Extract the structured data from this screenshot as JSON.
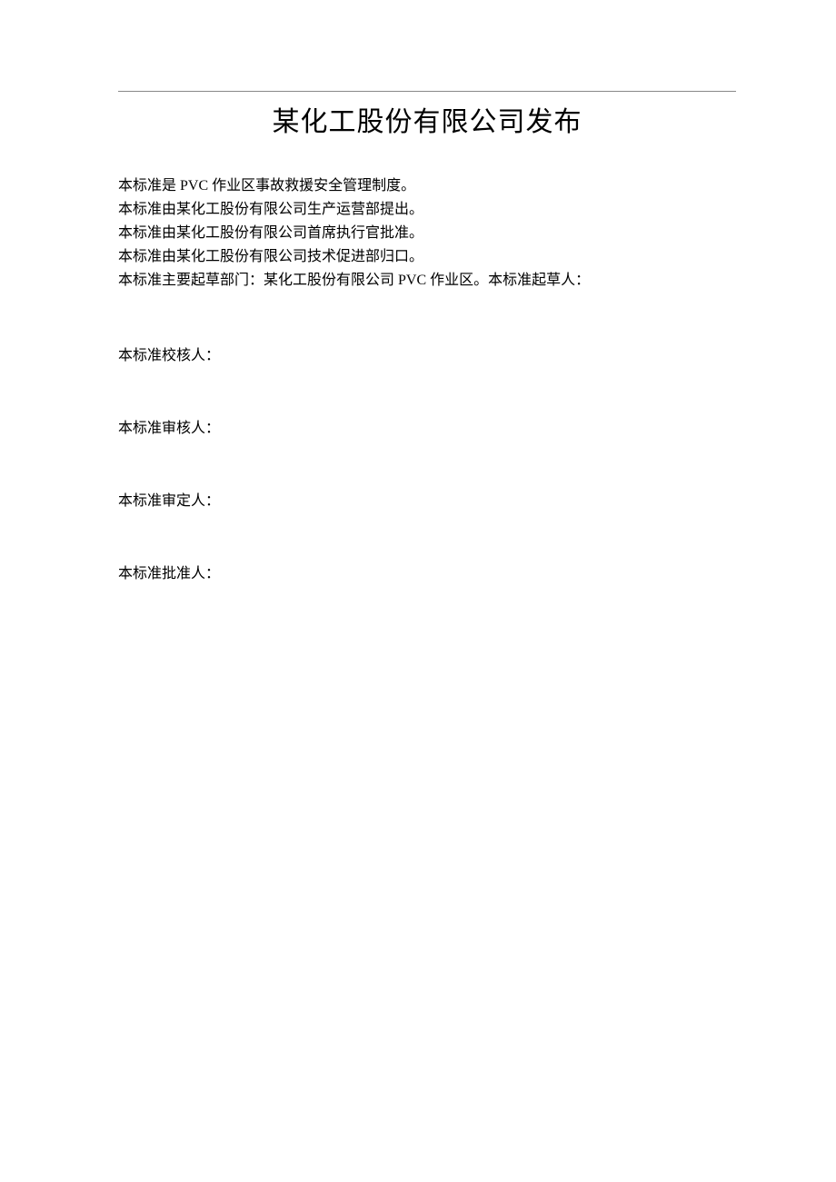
{
  "title": "某化工股份有限公司发布",
  "intro": {
    "line1": "本标准是 PVC 作业区事故救援安全管理制度。",
    "line2": "本标准由某化工股份有限公司生产运营部提出。",
    "line3": "本标准由某化工股份有限公司首席执行官批准。",
    "line4": "本标准由某化工股份有限公司技术促进部归口。",
    "line5": "本标准主要起草部门：某化工股份有限公司 PVC 作业区。本标准起草人："
  },
  "signatures": {
    "proofreader": "本标准校核人：",
    "reviewer": "本标准审核人：",
    "approver": "本标准审定人：",
    "authorizer": "本标准批准人："
  }
}
